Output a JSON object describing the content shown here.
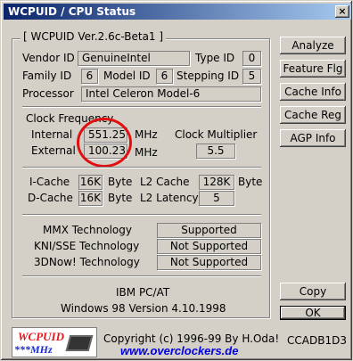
{
  "window": {
    "title": "WCPUID / CPU Status",
    "close_label": "×"
  },
  "group1": {
    "title": "[ WCPUID Ver.2.6c-Beta1 ]",
    "vendor_label": "Vendor ID",
    "vendor_value": "GenuineIntel",
    "type_label": "Type ID",
    "type_value": "0",
    "family_label": "Family ID",
    "family_value": "6",
    "model_label": "Model ID",
    "model_value": "6",
    "stepping_label": "Stepping ID",
    "stepping_value": "5",
    "processor_label": "Processor",
    "processor_value": "Intel Celeron Model-6",
    "clock_title": "Clock Frequency",
    "internal_label": "Internal",
    "internal_value": "551.25",
    "internal_unit": "MHz",
    "external_label": "External",
    "external_value": "100.23",
    "external_unit": "MHz",
    "multiplier_label": "Clock Multiplier",
    "multiplier_value": "5.5",
    "icache_label": "I-Cache",
    "icache_value": "16K",
    "icache_unit": "Byte",
    "dcache_label": "D-Cache",
    "dcache_value": "16K",
    "dcache_unit": "Byte",
    "l2cache_label": "L2 Cache",
    "l2cache_value": "128K",
    "l2cache_unit": "Byte",
    "l2latency_label": "L2 Latency",
    "l2latency_value": "5",
    "mmx_label": "MMX Technology",
    "mmx_value": "Supported",
    "sse_label": "KNI/SSE Technology",
    "sse_value": "Not Supported",
    "now_label": "3DNow! Technology",
    "now_value": "Not Supported",
    "platform": "IBM PC/AT",
    "os": "Windows 98  Version 4.10.1998"
  },
  "buttons": {
    "analyze": "Analyze",
    "feature": "Feature Flg",
    "cache_info": "Cache Info",
    "cache_reg": "Cache Reg",
    "agp_info": "AGP Info",
    "copy": "Copy",
    "ok": "OK"
  },
  "footer": {
    "logo_top": "WCPUID",
    "logo_bottom": "***MHz",
    "copyright": "Copyright (c) 1996-99  By H.Oda!",
    "code": "CCADB1D3",
    "url": "www.overclockers.de"
  },
  "colors": {
    "title_start": "#0a246a",
    "title_end": "#a6caf0",
    "highlight_oval": "#e01010",
    "link": "#0000e0"
  }
}
